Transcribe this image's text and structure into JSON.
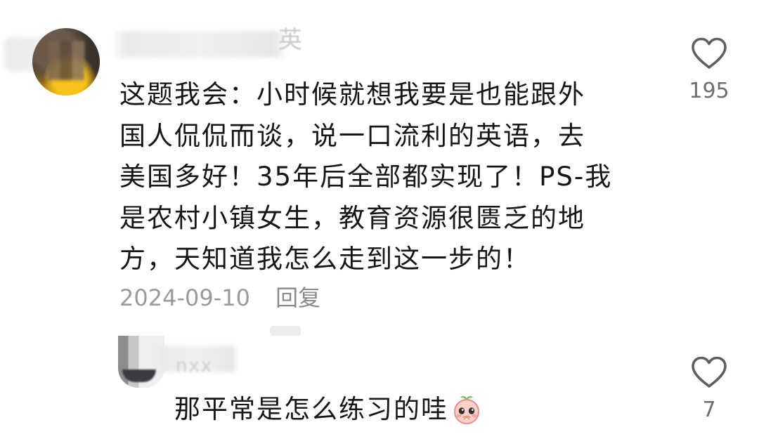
{
  "comment": {
    "username_tail": "英",
    "text": "这题我会：小时候就想我要是也能跟外\n国人侃侃而谈，说一口流利的英语，去\n美国多好！35年后全部都实现了！PS-我\n是农村小镇女生，教育资源很匮乏的地\n方，天知道我怎么走到这一步的！",
    "date": "2024-09-10",
    "reply_label": "回复",
    "likes": "195"
  },
  "reply": {
    "username_tail": "nxx",
    "text": "那平常是怎么练习的哇",
    "emoji": "peach-face-emoji",
    "likes": "7"
  },
  "icons": {
    "like": "heart-outline-icon"
  },
  "colors": {
    "text": "#161616",
    "meta": "#9a9a9a",
    "icon": "#5f5f5f"
  }
}
